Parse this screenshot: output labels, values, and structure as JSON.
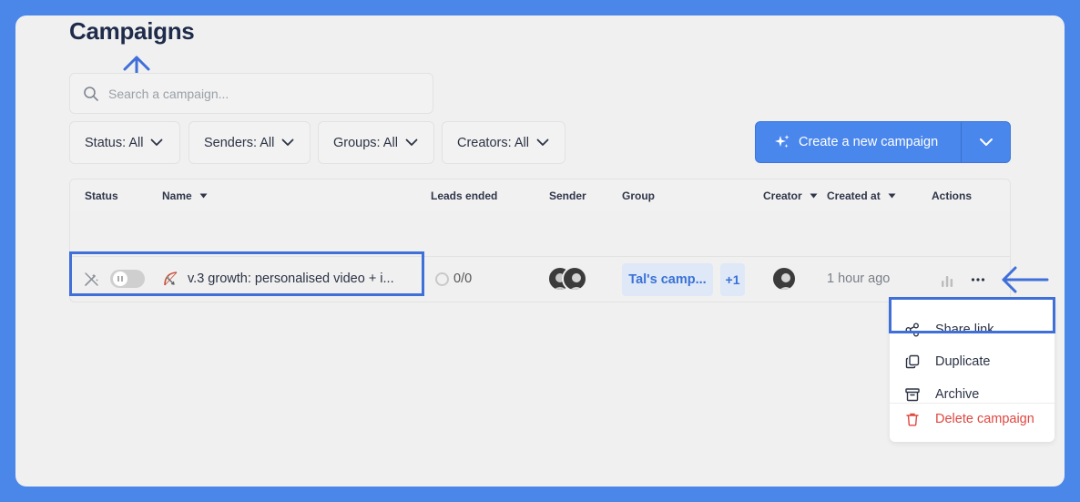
{
  "page": {
    "title": "Campaigns"
  },
  "search": {
    "placeholder": "Search a campaign..."
  },
  "filters": [
    {
      "label": "Status: All"
    },
    {
      "label": "Senders: All"
    },
    {
      "label": "Groups: All"
    },
    {
      "label": "Creators: All"
    }
  ],
  "create_button": {
    "label": "Create a new campaign"
  },
  "table": {
    "headers": {
      "status": "Status",
      "name": "Name",
      "leads_ended": "Leads ended",
      "sender": "Sender",
      "group": "Group",
      "creator": "Creator",
      "created_at": "Created at",
      "actions": "Actions"
    },
    "rows": [
      {
        "name": "v.3 growth: personalised video + i...",
        "leads_ended": "0/0",
        "group": "Tal's camp...",
        "group_extra": "+1",
        "created_at": "1 hour ago",
        "status": "paused"
      }
    ]
  },
  "actions_menu": {
    "items": [
      {
        "label": "Share link"
      },
      {
        "label": "Duplicate"
      },
      {
        "label": "Archive"
      },
      {
        "label": "Delete campaign"
      }
    ]
  },
  "colors": {
    "accent": "#4a87ec",
    "frame": "#4a87e8",
    "title": "#1e2b4a",
    "danger": "#e0473f",
    "chip_bg": "#dfe8f7",
    "highlight": "#3f6fd8"
  },
  "icons": {
    "search": "search-icon",
    "chevron": "chevron-down-icon",
    "sparkle": "sparkle-icon",
    "sort": "sort-caret-icon",
    "edit": "magic-wand-icon",
    "campaign": "bow-arrow-icon",
    "stats": "bar-chart-icon",
    "more": "more-horizontal-icon",
    "share": "share-icon",
    "duplicate": "copy-icon",
    "archive": "archive-icon",
    "delete": "trash-icon",
    "arrow": "annotation-arrow-icon"
  }
}
